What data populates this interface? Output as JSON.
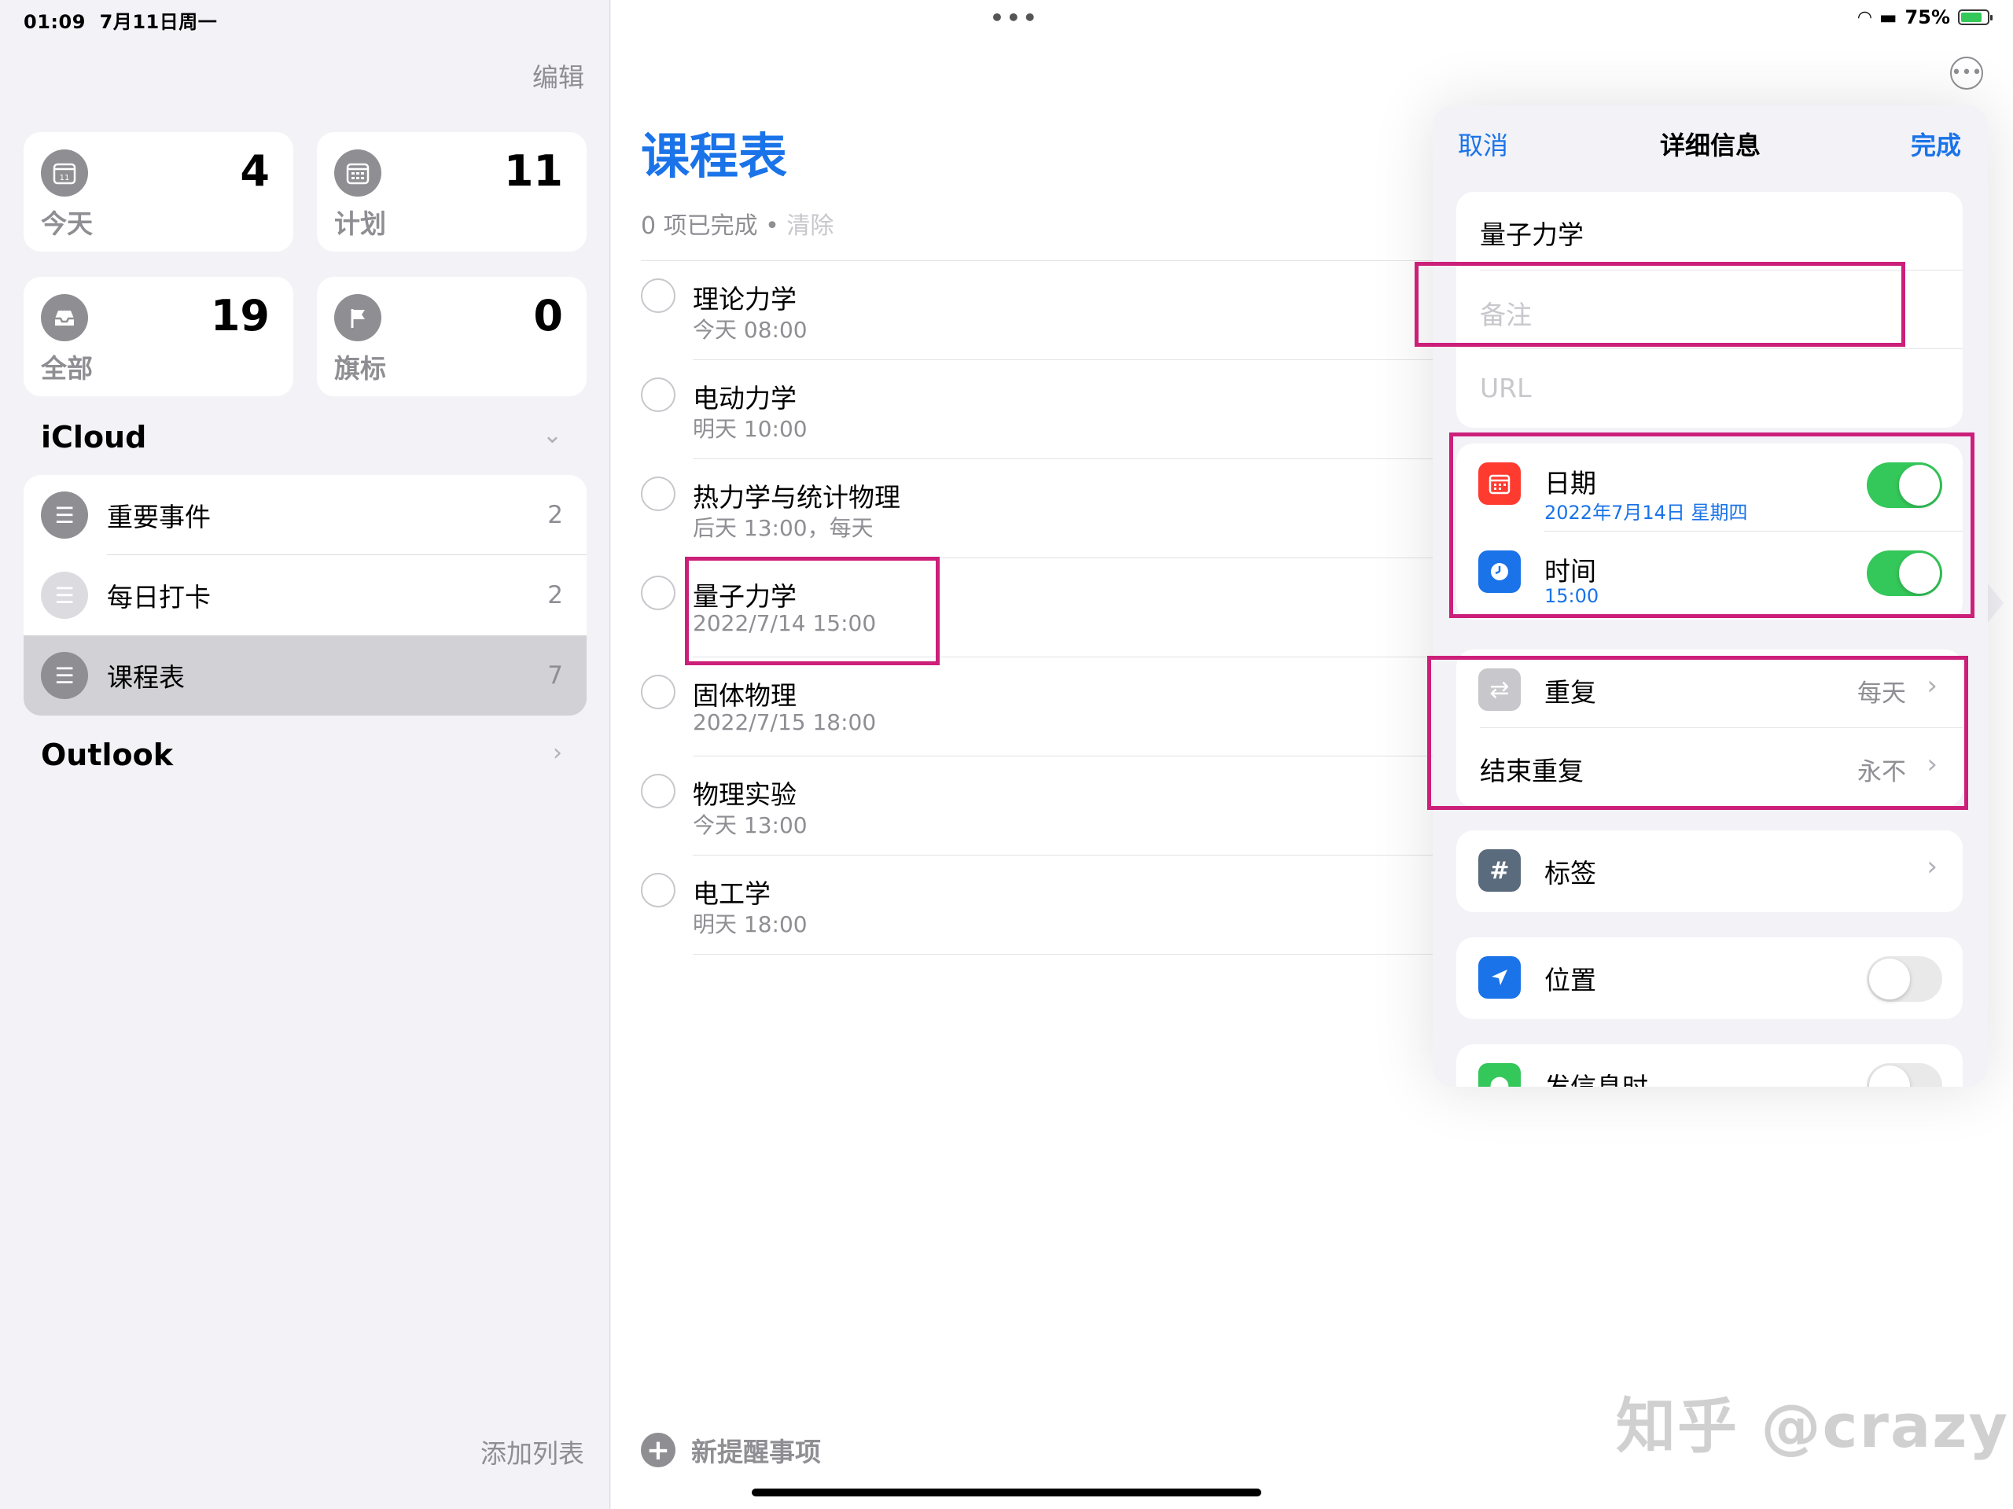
{
  "status": {
    "time": "01:09",
    "date": "7月11日周一",
    "battery": "75%"
  },
  "sidebar": {
    "edit": "编辑",
    "smart": [
      {
        "label": "今天",
        "count": "4",
        "icon": "calendar-icon"
      },
      {
        "label": "计划",
        "count": "11",
        "icon": "calendar-grid-icon"
      },
      {
        "label": "全部",
        "count": "19",
        "icon": "tray-icon"
      },
      {
        "label": "旗标",
        "count": "0",
        "icon": "flag-icon"
      }
    ],
    "icloud": "iCloud",
    "lists": [
      {
        "label": "重要事件",
        "count": "2"
      },
      {
        "label": "每日打卡",
        "count": "2"
      },
      {
        "label": "课程表",
        "count": "7"
      }
    ],
    "outlook": "Outlook",
    "add_list": "添加列表"
  },
  "main": {
    "title": "课程表",
    "completed": "0 项已完成",
    "dot": "•",
    "clear": "清除",
    "tasks": [
      {
        "title": "理论力学",
        "sub": "今天 08:00"
      },
      {
        "title": "电动力学",
        "sub": "明天 10:00"
      },
      {
        "title": "热力学与统计物理",
        "sub": "后天 13:00，每天"
      },
      {
        "title": "量子力学",
        "sub": "2022/7/14 15:00"
      },
      {
        "title": "固体物理",
        "sub": "2022/7/15 18:00"
      },
      {
        "title": "物理实验",
        "sub": "今天 13:00"
      },
      {
        "title": "电工学",
        "sub": "明天 18:00"
      }
    ],
    "new_reminder": "新提醒事项"
  },
  "detail": {
    "cancel": "取消",
    "title": "详细信息",
    "done": "完成",
    "name": "量子力学",
    "notes_placeholder": "备注",
    "url_placeholder": "URL",
    "date_label": "日期",
    "date_value": "2022年7月14日 星期四",
    "date_on": true,
    "time_label": "时间",
    "time_value": "15:00",
    "time_on": true,
    "repeat_label": "重复",
    "repeat_value": "每天",
    "end_repeat_label": "结束重复",
    "end_repeat_value": "永不",
    "tags_label": "标签",
    "location_label": "位置",
    "location_on": false,
    "messaging_label": "发信息时",
    "messaging_on": false
  },
  "watermark": "知乎 @crazy"
}
